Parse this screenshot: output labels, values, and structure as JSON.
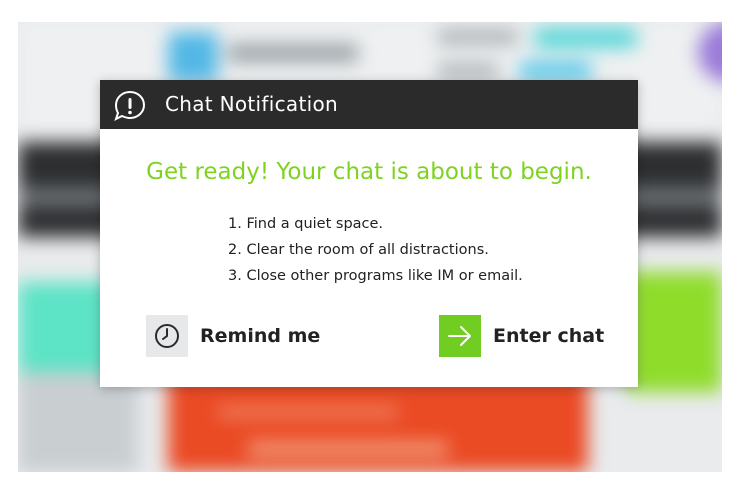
{
  "dialog": {
    "title": "Chat Notification",
    "heading": "Get ready! Your chat is about to begin.",
    "steps": [
      "1. Find a quiet space.",
      "2. Clear the room of all distractions.",
      "3. Close other programs like IM or email."
    ],
    "remind_label": "Remind me",
    "enter_label": "Enter chat",
    "header_icon": "alert-speech-bubble-icon",
    "remind_icon": "clock-icon",
    "enter_icon": "arrow-right-icon"
  },
  "colors": {
    "header_bg": "#2b2b2b",
    "accent_green": "#7ed321",
    "enter_button_bg": "#72cd23",
    "remind_button_bg": "#e6e8ea"
  }
}
